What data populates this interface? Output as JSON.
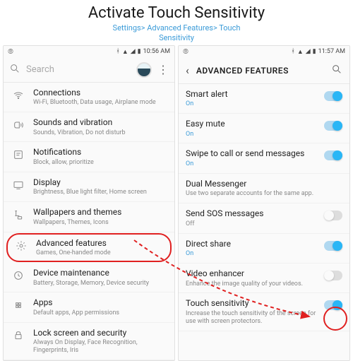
{
  "header": {
    "title": "Activate Touch Sensitivity",
    "breadcrumb_line1": "Settings> Advanced Features> Touch",
    "breadcrumb_line2": "Sensitivity"
  },
  "left": {
    "statusbar": {
      "time": "10:56 AM",
      "battery": "▮"
    },
    "search": {
      "placeholder": "Search"
    },
    "items": [
      {
        "label": "Connections",
        "sub": "Wi-Fi, Bluetooth, Data usage, Airplane mode"
      },
      {
        "label": "Sounds and vibration",
        "sub": "Sounds, Vibration, Do not disturb"
      },
      {
        "label": "Notifications",
        "sub": "Block, allow, prioritize"
      },
      {
        "label": "Display",
        "sub": "Brightness, Blue light filter, Home screen"
      },
      {
        "label": "Wallpapers and themes",
        "sub": "Wallpapers, Themes, Icons"
      },
      {
        "label": "Advanced features",
        "sub": "Games, One-handed mode"
      },
      {
        "label": "Device maintenance",
        "sub": "Battery, Storage, Memory, Device security"
      },
      {
        "label": "Apps",
        "sub": "Default apps, App permissions"
      },
      {
        "label": "Lock screen and security",
        "sub": "Always On Display, Face Recognition, Fingerprints, Iris"
      }
    ]
  },
  "right": {
    "statusbar": {
      "time": "11:57 AM",
      "battery": "▮"
    },
    "title": "ADVANCED FEATURES",
    "items": [
      {
        "label": "Smart alert",
        "sub": "On",
        "on": true,
        "toggle": true,
        "toggledOn": true
      },
      {
        "label": "Easy mute",
        "sub": "On",
        "on": true,
        "toggle": true,
        "toggledOn": true
      },
      {
        "label": "Swipe to call or send messages",
        "sub": "On",
        "on": true,
        "toggle": true,
        "toggledOn": true
      },
      {
        "label": "Dual Messenger",
        "sub": "Use two separate accounts for the same app.",
        "toggle": false
      },
      {
        "label": "Send SOS messages",
        "sub": "Off",
        "toggle": true,
        "toggledOn": false
      },
      {
        "label": "Direct share",
        "sub": "On",
        "on": true,
        "toggle": true,
        "toggledOn": true
      },
      {
        "label": "Video enhancer",
        "sub": "Enhance the image quality of your videos.",
        "toggle": true,
        "toggledOn": false
      },
      {
        "label": "Touch sensitivity",
        "sub": "Increase the touch sensitivity of the screen for use with screen protectors.",
        "toggle": true,
        "toggledOn": true
      }
    ]
  }
}
